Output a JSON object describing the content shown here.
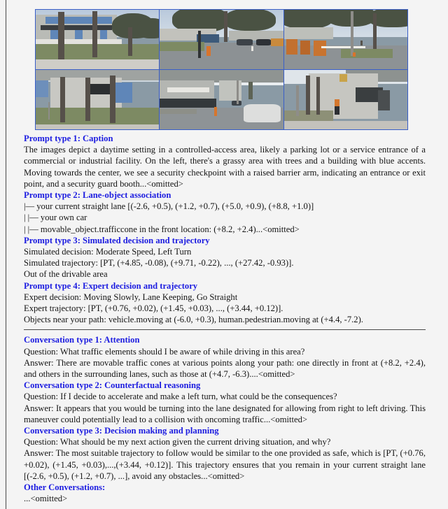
{
  "figure": {
    "name": "driving-scene-panorama",
    "border_color": "#3a5fc8",
    "rows": [
      {
        "cells": [
          {
            "name": "cam-front-left",
            "caption": "Building with blue accents, grassy area with trees, concrete pillars"
          },
          {
            "name": "cam-front",
            "caption": "Road with security booth, traffic cones, parked cars, trees"
          },
          {
            "name": "cam-front-right",
            "caption": "Security checkpoint with raised barrier arm and guard booth"
          }
        ]
      },
      {
        "cells": [
          {
            "name": "cam-back-left",
            "caption": "Concrete building facade, grass strip, pillars"
          },
          {
            "name": "cam-back",
            "caption": "White car under overpass on roadway"
          },
          {
            "name": "cam-back-right",
            "caption": "Pedestrian in orange shirt walking beside building"
          }
        ]
      }
    ]
  },
  "colors": {
    "heading_blue": "#1c1ce0",
    "body_black": "#141414",
    "page_background": "#f4f4f4",
    "rule_gray": "#4a4a4a"
  },
  "sections": {
    "prompt_1": {
      "heading": "Prompt type 1: Caption",
      "body": "The images depict a daytime setting in a controlled-access area, likely a parking lot or a service entrance of a commercial or industrial facility. On the left, there's a grassy area with trees and a building with blue accents. Moving towards the center, we see a security checkpoint with a raised barrier arm, indicating an entrance or exit point, and a security guard booth...<omitted>"
    },
    "prompt_2": {
      "heading": "Prompt type 2: Lane-object association",
      "lines": [
        "|— your current straight lane [(-2.6, +0.5), (+1.2, +0.7), (+5.0, +0.9), (+8.8, +1.0)]",
        "|   |— your own car",
        "|   |— movable_object.trafficcone in the front location: (+8.2, +2.4)...<omitted>"
      ]
    },
    "prompt_3": {
      "heading": "Prompt type 3: Simulated decision and trajectory",
      "lines": [
        "Simulated decision: Moderate Speed, Left Turn",
        "Simulated trajectory: [PT, (+4.85, -0.08), (+9.71, -0.22), ..., (+27.42, -0.93)].",
        "Out of the drivable area"
      ]
    },
    "prompt_4": {
      "heading": "Prompt type 4: Expert decision and trajectory",
      "lines": [
        "Expert decision: Moving Slowly, Lane Keeping, Go Straight",
        "Expert trajectory: [PT, (+0.76, +0.02), (+1.45, +0.03), ..., (+3.44, +0.12)].",
        "Objects near your path: vehicle.moving at (-6.0, +0.3), human.pedestrian.moving at (+4.4, -7.2)."
      ]
    },
    "conversation_1": {
      "heading": "Conversation type 1: Attention",
      "question": "Question: What traffic elements should I be aware of while driving in this area?",
      "answer": "Answer: There are movable traffic cones at various points along your path: one directly in front at (+8.2, +2.4), and others in the surrounding lanes, such as those at (+4.7, -6.3)....<omitted>"
    },
    "conversation_2": {
      "heading": "Conversation type 2: Counterfactual reasoning",
      "question": "Question: If I decide to accelerate and make a left turn, what could be the consequences?",
      "answer": "Answer: It appears that you would be turning into the lane designated for allowing from right to left driving. This maneuver could potentially lead to a collision with oncoming traffic...<omitted>"
    },
    "conversation_3": {
      "heading": "Conversation type 3: Decision making and planning",
      "question": "Question: What should be my next action given the current driving situation, and why?",
      "answer": "Answer: The most suitable trajectory to follow would be similar to the one provided as safe, which is [PT, (+0.76, +0.02), (+1.45, +0.03),...,(+3.44, +0.12)]. This trajectory ensures that you remain in your current straight lane [(-2.6, +0.5), (+1.2, +0.7), ...], avoid any obstacles...<omitted>"
    },
    "other_conversations": {
      "heading": "Other Conversations:",
      "body": "...<omitted>"
    }
  }
}
